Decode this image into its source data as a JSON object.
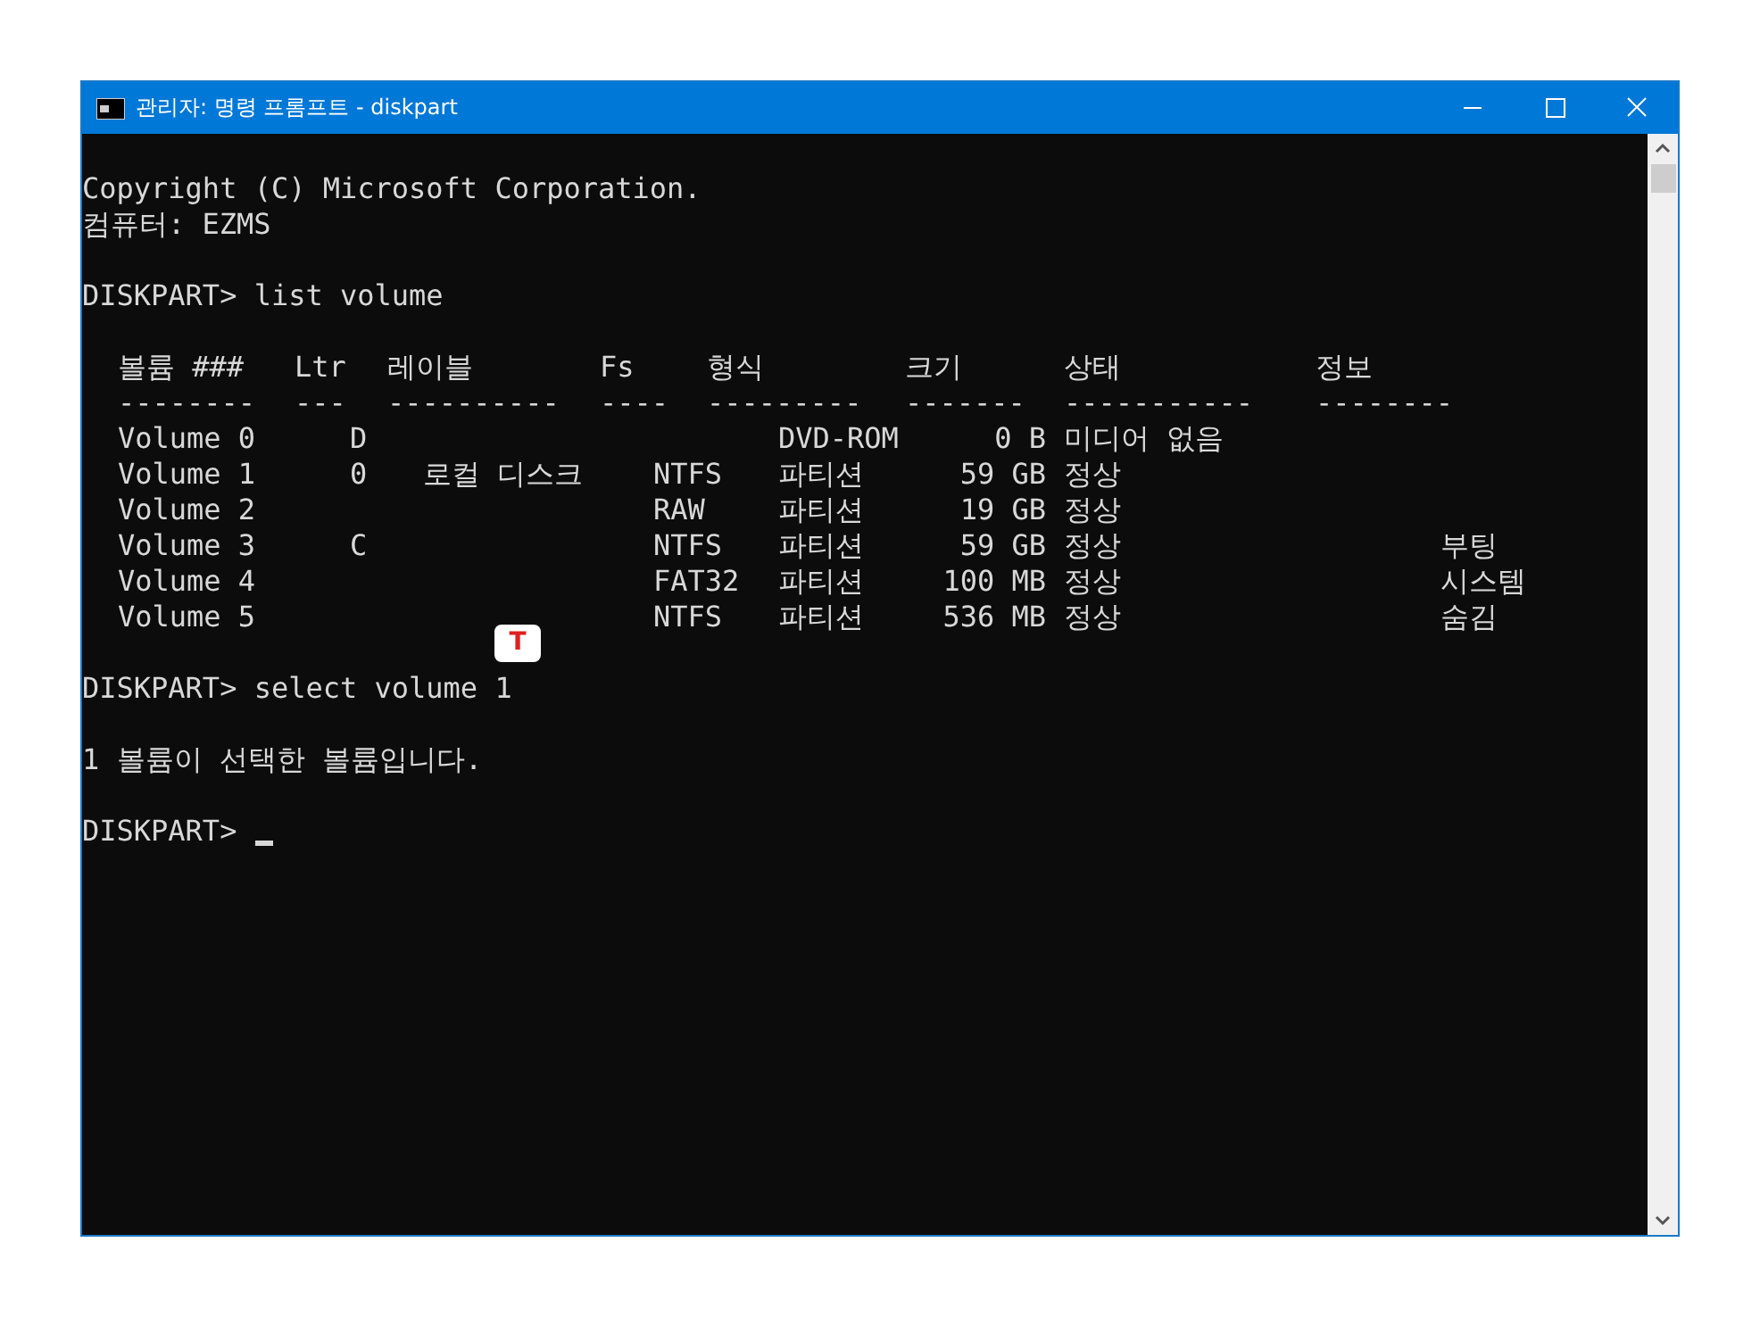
{
  "window": {
    "title": "관리자: 명령 프롬프트 - diskpart"
  },
  "console": {
    "blocks": [
      {
        "kind": "text",
        "lines": [
          "Copyright (C) Microsoft Corporation.",
          "컴퓨터: EZMS"
        ]
      },
      {
        "kind": "text",
        "lines": [
          "DISKPART> list volume"
        ]
      },
      {
        "kind": "table",
        "columns": [
          {
            "heading": "볼륨 ###",
            "rule": "--------"
          },
          {
            "heading": "Ltr",
            "rule": "---"
          },
          {
            "heading": "레이블",
            "rule": "----------"
          },
          {
            "heading": "Fs",
            "rule": "----"
          },
          {
            "heading": "형식",
            "rule": "---------"
          },
          {
            "heading": "크기",
            "rule": "-------"
          },
          {
            "heading": "상태",
            "rule": "-----------"
          },
          {
            "heading": "정보",
            "rule": "--------"
          }
        ],
        "rows": [
          {
            "volume": "Volume 0",
            "ltr": "D",
            "type": "DVD-ROM",
            "size": "0 B",
            "status": "미디어 없음"
          },
          {
            "volume": "Volume 1",
            "ltr": "0",
            "label": "로컬 디스크",
            "fs": "NTFS",
            "type": "파티션",
            "size": "59 GB",
            "status": "정상"
          },
          {
            "volume": "Volume 2",
            "fs": "RAW",
            "type": "파티션",
            "size": "19 GB",
            "status": "정상"
          },
          {
            "volume": "Volume 3",
            "ltr": "C",
            "fs": "NTFS",
            "type": "파티션",
            "size": "59 GB",
            "status": "정상",
            "info": "부팅"
          },
          {
            "volume": "Volume 4",
            "fs": "FAT32",
            "type": "파티션",
            "size": "100 MB",
            "status": "정상",
            "info": "시스템"
          },
          {
            "volume": "Volume 5",
            "fs": "NTFS",
            "type": "파티션",
            "size": "536 MB",
            "status": "정상",
            "info": "숨김"
          }
        ]
      },
      {
        "kind": "text",
        "lines": [
          "DISKPART> select volume 1"
        ]
      },
      {
        "kind": "text",
        "lines": [
          "1 볼륨이 선택한 볼륨입니다."
        ]
      },
      {
        "kind": "prompt",
        "text": "DISKPART>",
        "cursor": true
      }
    ]
  },
  "annotation_badge": "T"
}
